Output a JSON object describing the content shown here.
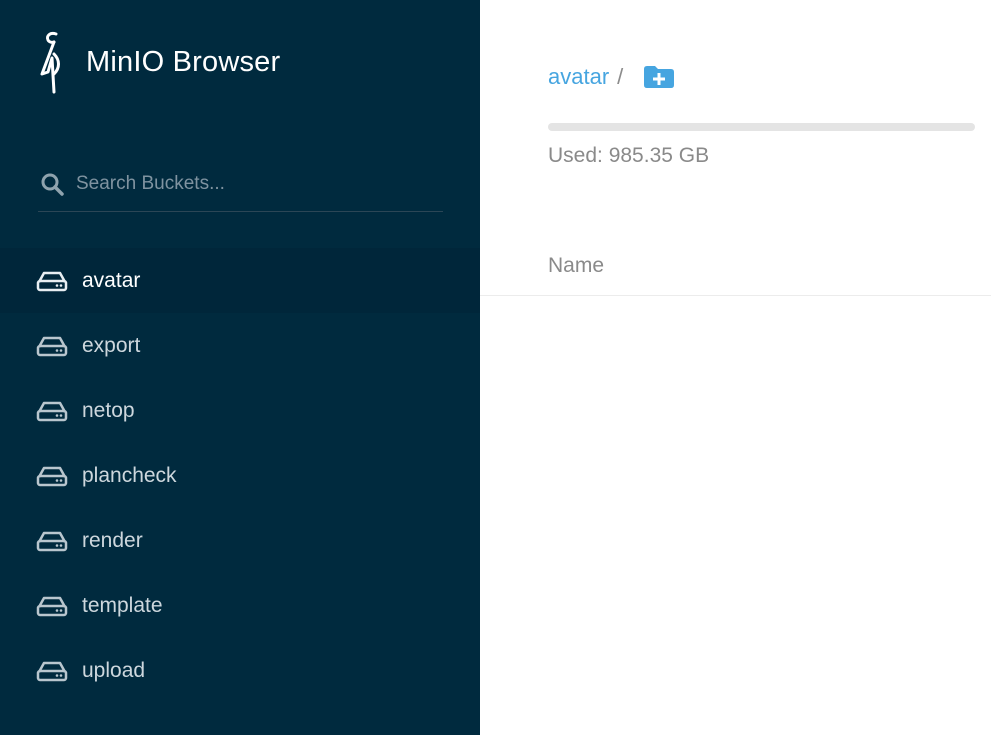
{
  "sidebar": {
    "brand": {
      "title": "MinIO Browser",
      "logo_icon": "minio-bird-logo"
    },
    "search": {
      "placeholder": "Search Buckets...",
      "value": ""
    },
    "buckets": [
      {
        "label": "avatar",
        "active": true
      },
      {
        "label": "export",
        "active": false
      },
      {
        "label": "netop",
        "active": false
      },
      {
        "label": "plancheck",
        "active": false
      },
      {
        "label": "render",
        "active": false
      },
      {
        "label": "template",
        "active": false
      },
      {
        "label": "upload",
        "active": false
      }
    ]
  },
  "main": {
    "breadcrumb": {
      "bucket": "avatar",
      "separator": "/"
    },
    "usage": {
      "prefix": "Used: ",
      "value": "985.35 GB"
    },
    "table": {
      "columns": [
        {
          "label": "Name"
        }
      ]
    }
  },
  "colors": {
    "sidebar_bg": "#002a3e",
    "active_bucket_bg": "#00263a",
    "link": "#46a5e0",
    "muted_text": "#8a8a8a"
  }
}
